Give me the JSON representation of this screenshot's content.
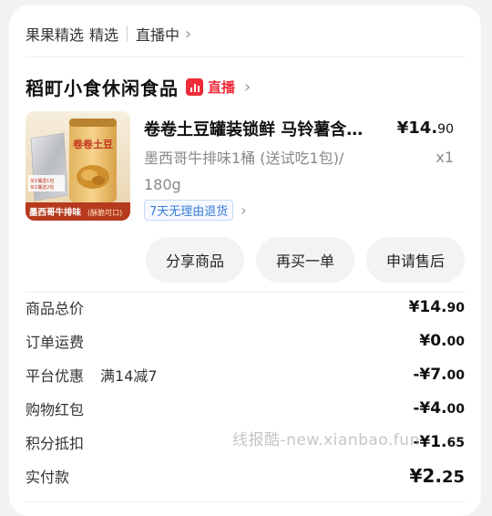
{
  "source": {
    "label": "果果精选",
    "sub": "精选",
    "live_status": "直播中"
  },
  "shop": {
    "name": "稻町小食休闲食品",
    "badge": "直播"
  },
  "product": {
    "title": "卷卷土豆罐装锁鲜 马铃薯含…",
    "price": "¥14.",
    "price_dec": "90",
    "spec": "墨西哥牛排味1桶 (送试吃1包)/ 180g",
    "quantity": "x1",
    "service_tag": "7天无理由退货",
    "image": {
      "can_text": "卷卷土豆",
      "bag_text_1": "买1桶送1包",
      "bag_text_2": "买1桶送2包",
      "flavor_label": "墨西哥牛排味",
      "flavor_note": "(酥脆可口)"
    }
  },
  "actions": {
    "share": "分享商品",
    "rebuy": "再买一单",
    "after_sale": "申请售后"
  },
  "summary": [
    {
      "label": "商品总价",
      "extra": "",
      "amount": "¥14.",
      "dec": "90"
    },
    {
      "label": "订单运费",
      "extra": "",
      "amount": "¥0.",
      "dec": "00"
    },
    {
      "label": "平台优惠",
      "extra": "满14减7",
      "amount": "-¥7.",
      "dec": "00"
    },
    {
      "label": "购物红包",
      "extra": "",
      "amount": "-¥4.",
      "dec": "00"
    },
    {
      "label": "积分抵扣",
      "extra": "",
      "amount": "-¥1.",
      "dec": "65"
    }
  ],
  "total": {
    "label": "实付款",
    "amount": "¥2.",
    "dec": "25"
  },
  "watermark": "线报酷-new.xianbao.fun",
  "colors": {
    "accent_red": "#ef2c3a",
    "tag_blue": "#3a7bd5",
    "background": "#f2f2f2"
  }
}
